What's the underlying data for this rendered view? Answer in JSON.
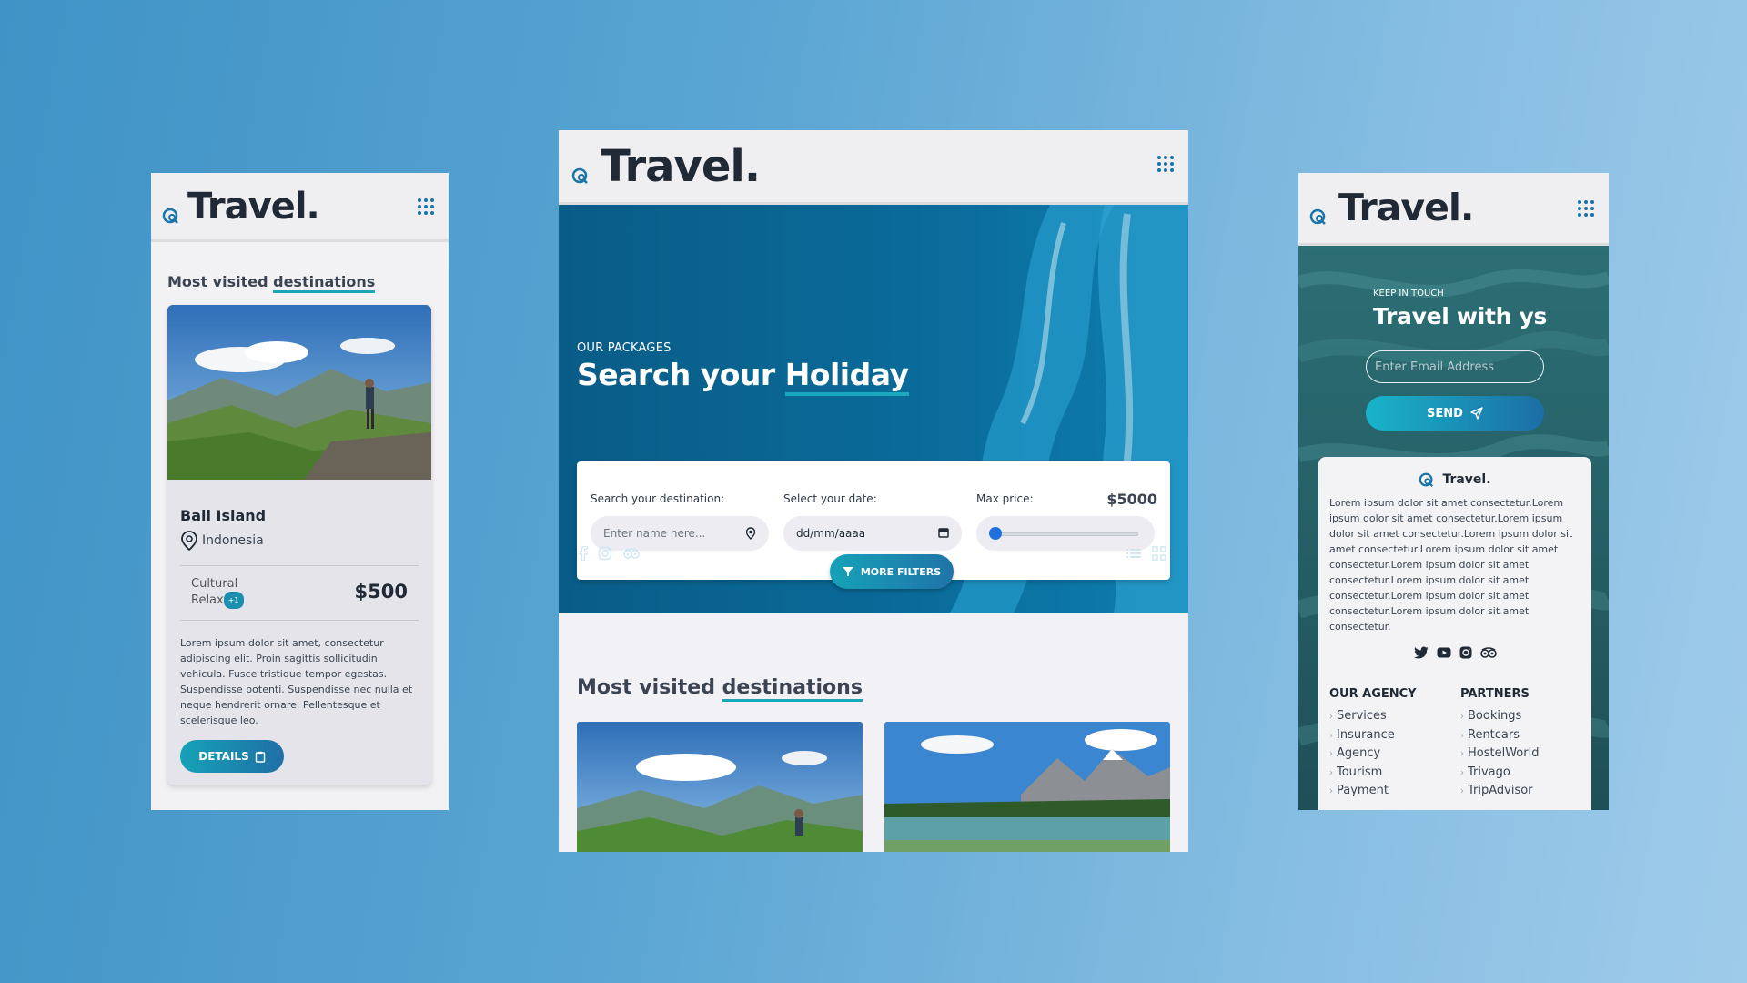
{
  "brand": {
    "name": "Travel."
  },
  "left": {
    "section_title_prefix": "Most visited",
    "section_title_highlight": "destinations",
    "card": {
      "name": "Bali Island",
      "location": "Indonesia",
      "tags": [
        "Cultural",
        "Relax"
      ],
      "tag_extra": "+1",
      "price": "$500",
      "description": "Lorem ipsum dolor sit amet, consectetur adipiscing elit. Proin sagittis sollicitudin vehicula. Fusce tristique tempor egestas. Suspendisse potenti. Suspendisse nec nulla et neque hendrerit ornare. Pellentesque et scelerisque leo.",
      "details_label": "DETAILS"
    }
  },
  "center": {
    "hero_eyebrow": "OUR PACKAGES",
    "hero_title_prefix": "Search your",
    "hero_title_highlight": "Holiday",
    "search": {
      "destination_label": "Search your destination:",
      "destination_placeholder": "Enter name here...",
      "date_label": "Select your date:",
      "date_placeholder": "dd/mm/aaaa",
      "price_label": "Max price:",
      "price_value": "$5000",
      "price_slider_level": 0.0,
      "filters_label": "MORE FILTERS"
    },
    "social_icons": [
      "facebook-icon",
      "instagram-icon",
      "tripadvisor-icon"
    ],
    "view_icons": [
      "list-view-icon",
      "grid-view-icon"
    ],
    "section_title_prefix": "Most visited",
    "section_title_highlight": "destinations"
  },
  "right": {
    "eyebrow": "KEEP IN TOUCH",
    "title": "Travel with ys",
    "email_placeholder": "Enter Email Address",
    "send_label": "SEND",
    "footer": {
      "brand": "Travel.",
      "lorem": "Lorem ipsum dolor sit amet consectetur.Lorem ipsum dolor sit amet consectetur.Lorem ipsum dolor sit amet consectetur.Lorem ipsum dolor sit amet consectetur.Lorem ipsum dolor sit amet consectetur.Lorem ipsum dolor sit amet consectetur.Lorem ipsum dolor sit amet consectetur.Lorem ipsum dolor sit amet consectetur.Lorem ipsum dolor sit amet consectetur.",
      "social_icons": [
        "twitter-icon",
        "youtube-icon",
        "instagram-icon",
        "tripadvisor-icon"
      ],
      "agency_heading": "OUR AGENCY",
      "agency_items": [
        "Services",
        "Insurance",
        "Agency",
        "Tourism",
        "Payment"
      ],
      "partners_heading": "PARTNERS",
      "partners_items": [
        "Bookings",
        "Rentcars",
        "HostelWorld",
        "Trivago",
        "TripAdvisor"
      ]
    }
  },
  "colors": {
    "accent": "#19a8bf",
    "brand_blue": "#1b74a8",
    "text_dark": "#1f2a36"
  }
}
